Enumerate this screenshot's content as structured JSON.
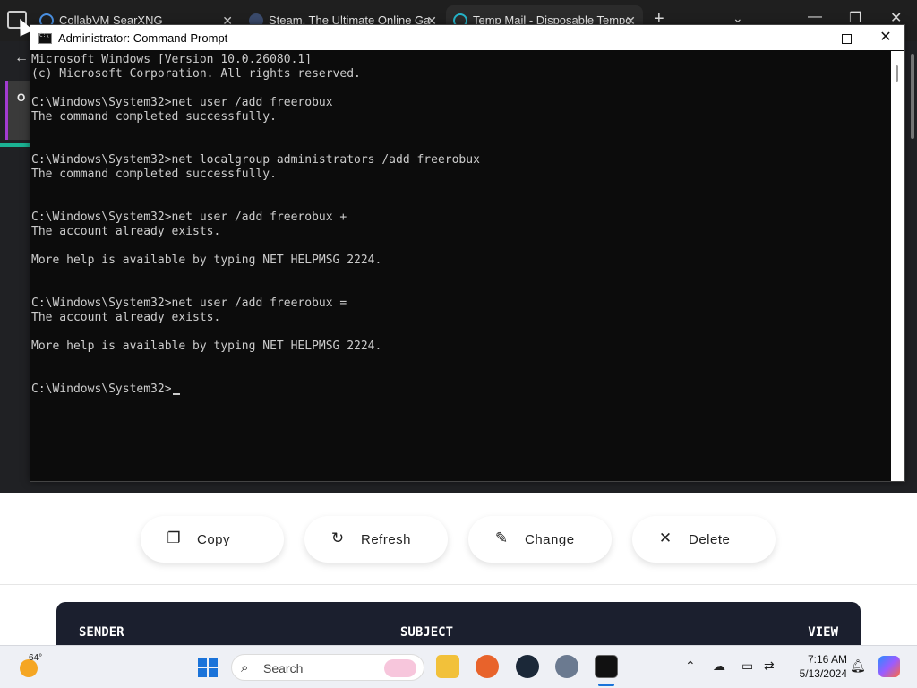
{
  "browser": {
    "tabs": [
      {
        "title": "CollabVM SearXNG"
      },
      {
        "title": "Steam, The Ultimate Online Ga"
      },
      {
        "title": "Temp Mail - Disposable Tempo"
      }
    ],
    "page_left_text": "O"
  },
  "cmd": {
    "title": "Administrator: Command Prompt",
    "lines": [
      "Microsoft Windows [Version 10.0.26080.1]",
      "(c) Microsoft Corporation. All rights reserved.",
      "",
      "C:\\Windows\\System32>net user /add freerobux",
      "The command completed successfully.",
      "",
      "",
      "C:\\Windows\\System32>net localgroup administrators /add freerobux",
      "The command completed successfully.",
      "",
      "",
      "C:\\Windows\\System32>net user /add freerobux +",
      "The account already exists.",
      "",
      "More help is available by typing NET HELPMSG 2224.",
      "",
      "",
      "C:\\Windows\\System32>net user /add freerobux =",
      "The account already exists.",
      "",
      "More help is available by typing NET HELPMSG 2224.",
      "",
      ""
    ],
    "prompt": "C:\\Windows\\System32>"
  },
  "mail": {
    "buttons": {
      "copy": "Copy",
      "refresh": "Refresh",
      "change": "Change",
      "delete": "Delete"
    },
    "inbox_columns": {
      "sender": "SENDER",
      "subject": "SUBJECT",
      "view": "VIEW"
    }
  },
  "taskbar": {
    "weather_temp": "64°",
    "search_placeholder": "Search",
    "time": "7:16 AM",
    "date": "5/13/2024"
  }
}
